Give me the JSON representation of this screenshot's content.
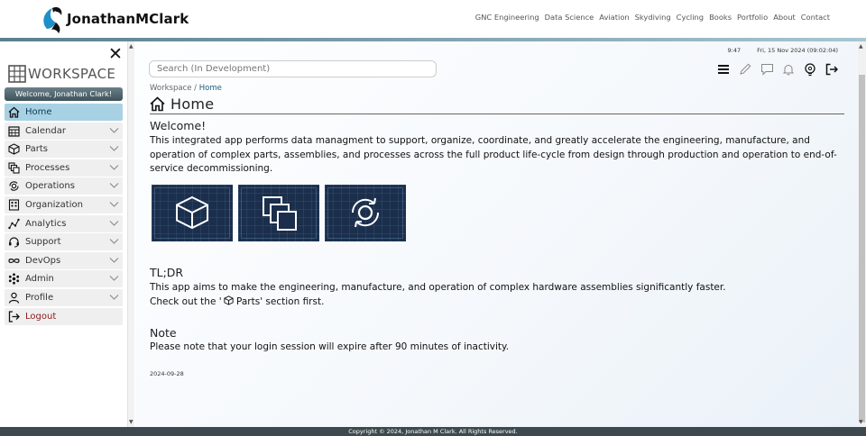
{
  "header": {
    "logo_text": "JonathanMClark",
    "nav": [
      "GNC Engineering",
      "Data Science",
      "Aviation",
      "Skydiving",
      "Cycling",
      "Books",
      "Portfolio",
      "About",
      "Contact"
    ]
  },
  "sidebar": {
    "title": "WORKSPACE",
    "welcome": "Welcome, Jonathan Clark!",
    "items": [
      {
        "label": "Home",
        "icon": "home-icon",
        "active": true
      },
      {
        "label": "Calendar",
        "icon": "calendar-icon"
      },
      {
        "label": "Parts",
        "icon": "cube-icon"
      },
      {
        "label": "Processes",
        "icon": "processes-icon"
      },
      {
        "label": "Operations",
        "icon": "operations-icon"
      },
      {
        "label": "Organization",
        "icon": "building-icon"
      },
      {
        "label": "Analytics",
        "icon": "analytics-icon"
      },
      {
        "label": "Support",
        "icon": "headset-icon"
      },
      {
        "label": "DevOps",
        "icon": "infinity-icon"
      },
      {
        "label": "Admin",
        "icon": "admin-icon"
      },
      {
        "label": "Profile",
        "icon": "user-icon"
      },
      {
        "label": "Logout",
        "icon": "logout-icon"
      }
    ]
  },
  "status": {
    "time": "9:47",
    "datetime": "Fri, 15 Nov 2024 (09:02:04)"
  },
  "search": {
    "placeholder": "Search (In Development)"
  },
  "toolbar": [
    "menu-icon",
    "pencil-icon",
    "comment-icon",
    "bell-icon",
    "lightbulb-icon",
    "logout-icon"
  ],
  "breadcrumb": {
    "root": "Workspace",
    "sep": " / ",
    "current": "Home"
  },
  "page": {
    "title": "Home",
    "welcome_heading": "Welcome!",
    "intro": "This integrated app performs data managment to support, organize, coordinate, and greatly accelerate the engineering, manufacture, and operation of complex parts, assemblies, and processes across the full product life-cycle from design through production and operation to end-of-service decommissioning.",
    "tiles": [
      "parts-tile",
      "processes-tile",
      "operations-tile"
    ],
    "tldr_heading": "TL;DR",
    "tldr_line1": "This app aims to make the engineering, manufacture, and operation of complex hardware assemblies significantly faster.",
    "tldr_line2_pre": "Check out the '",
    "tldr_line2_link": " Parts",
    "tldr_line2_post": "' section first.",
    "note_heading": "Note",
    "note_text": "Please note that your login session will expire after 90 minutes of inactivity.",
    "date": "2024-09-28"
  },
  "footer": {
    "text": "Copyright © 2024, Jonathan M Clark. All Rights Reserved."
  },
  "colors": {
    "accent": "#a8d1e3",
    "tile": "#1b2f4c",
    "footer": "#3c4a4f",
    "logout": "#8b1a1a"
  }
}
